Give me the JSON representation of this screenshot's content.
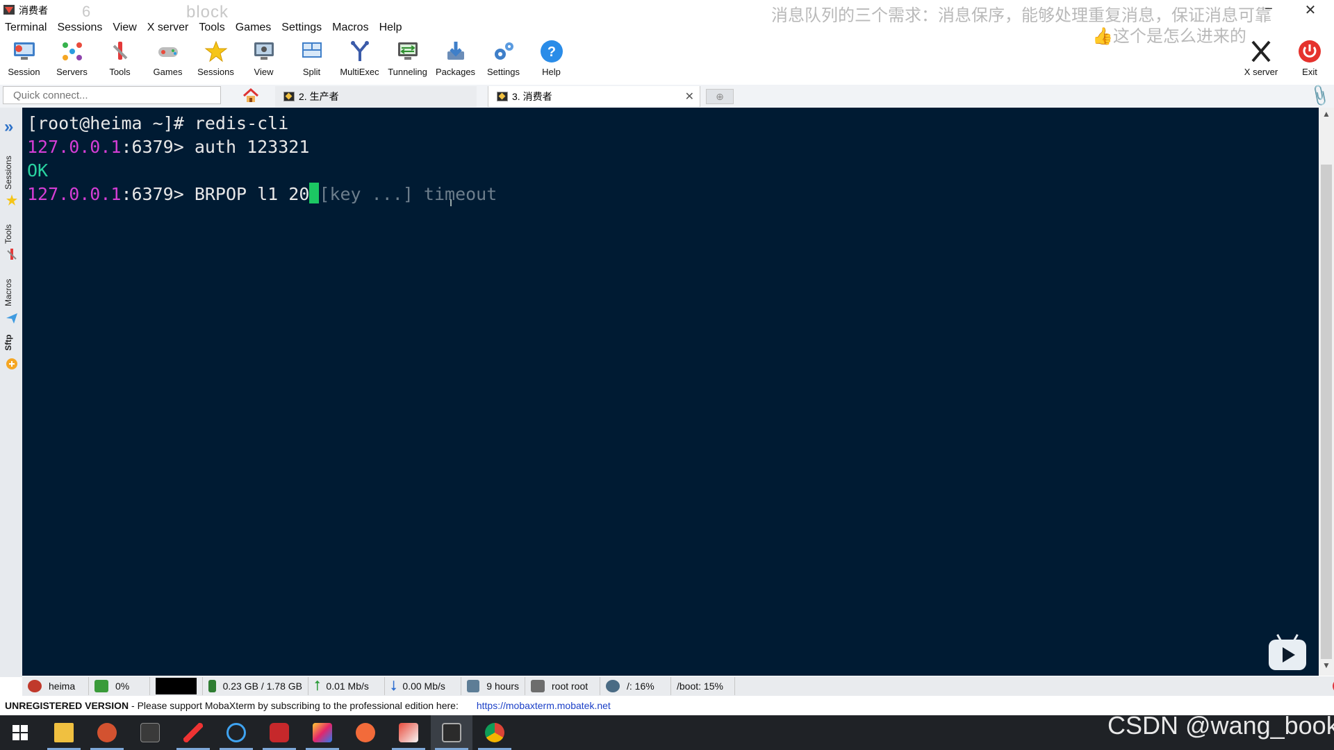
{
  "window": {
    "title": "消费者",
    "ghost_text_1": "6",
    "ghost_text_2": "block",
    "overlay_caption_1": "消息队列的三个需求：消息保序，能够处理重复消息，保证消息可靠",
    "overlay_caption_2": "👍这个是怎么进来的"
  },
  "menu": [
    "Terminal",
    "Sessions",
    "View",
    "X server",
    "Tools",
    "Games",
    "Settings",
    "Macros",
    "Help"
  ],
  "toolbar": [
    {
      "label": "Session",
      "icon": "session-icon"
    },
    {
      "label": "Servers",
      "icon": "servers-icon"
    },
    {
      "label": "Tools",
      "icon": "tools-icon"
    },
    {
      "label": "Games",
      "icon": "games-icon"
    },
    {
      "label": "Sessions",
      "icon": "star-icon"
    },
    {
      "label": "View",
      "icon": "view-icon"
    },
    {
      "label": "Split",
      "icon": "split-icon"
    },
    {
      "label": "MultiExec",
      "icon": "multiexec-icon"
    },
    {
      "label": "Tunneling",
      "icon": "tunneling-icon"
    },
    {
      "label": "Packages",
      "icon": "packages-icon"
    },
    {
      "label": "Settings",
      "icon": "settings-icon"
    },
    {
      "label": "Help",
      "icon": "help-icon"
    }
  ],
  "toolbar_right": {
    "xserver_label": "X server",
    "exit_label": "Exit"
  },
  "quick_connect": {
    "placeholder": "Quick connect..."
  },
  "tabs": [
    {
      "label": "2. 生产者",
      "active": false
    },
    {
      "label": "3. 消费者",
      "active": true
    }
  ],
  "side_panel": [
    "Sessions",
    "Tools",
    "Macros",
    "Sftp"
  ],
  "terminal": {
    "line1": "[root@heima ~]# redis-cli",
    "line2_ip": "127.0.0.1",
    "line2_rest": ":6379> auth 123321",
    "line3": "OK",
    "line4_ip": "127.0.0.1",
    "line4_rest": ":6379> BRPOP l1 20",
    "line4_hint": "[key ...] timeout"
  },
  "statusbar": {
    "host": "heima",
    "cpu": "0%",
    "memory": "0.23 GB / 1.78 GB",
    "upload": "0.01 Mb/s",
    "download": "0.00 Mb/s",
    "uptime": "9 hours",
    "users": "root  root",
    "disk_root": "/: 16%",
    "disk_boot": "/boot: 15%"
  },
  "footer": {
    "unregistered": "UNREGISTERED VERSION",
    "message": "  -  Please support MobaXterm by subscribing to the professional edition here:",
    "link": "https://mobaxterm.mobatek.net"
  },
  "watermark": "CSDN @wang_book",
  "colors": {
    "terminal_bg": "#001b33",
    "prompt_ip": "#d63ed6",
    "ok_text": "#29d3a0",
    "cursor": "#1cc763"
  }
}
